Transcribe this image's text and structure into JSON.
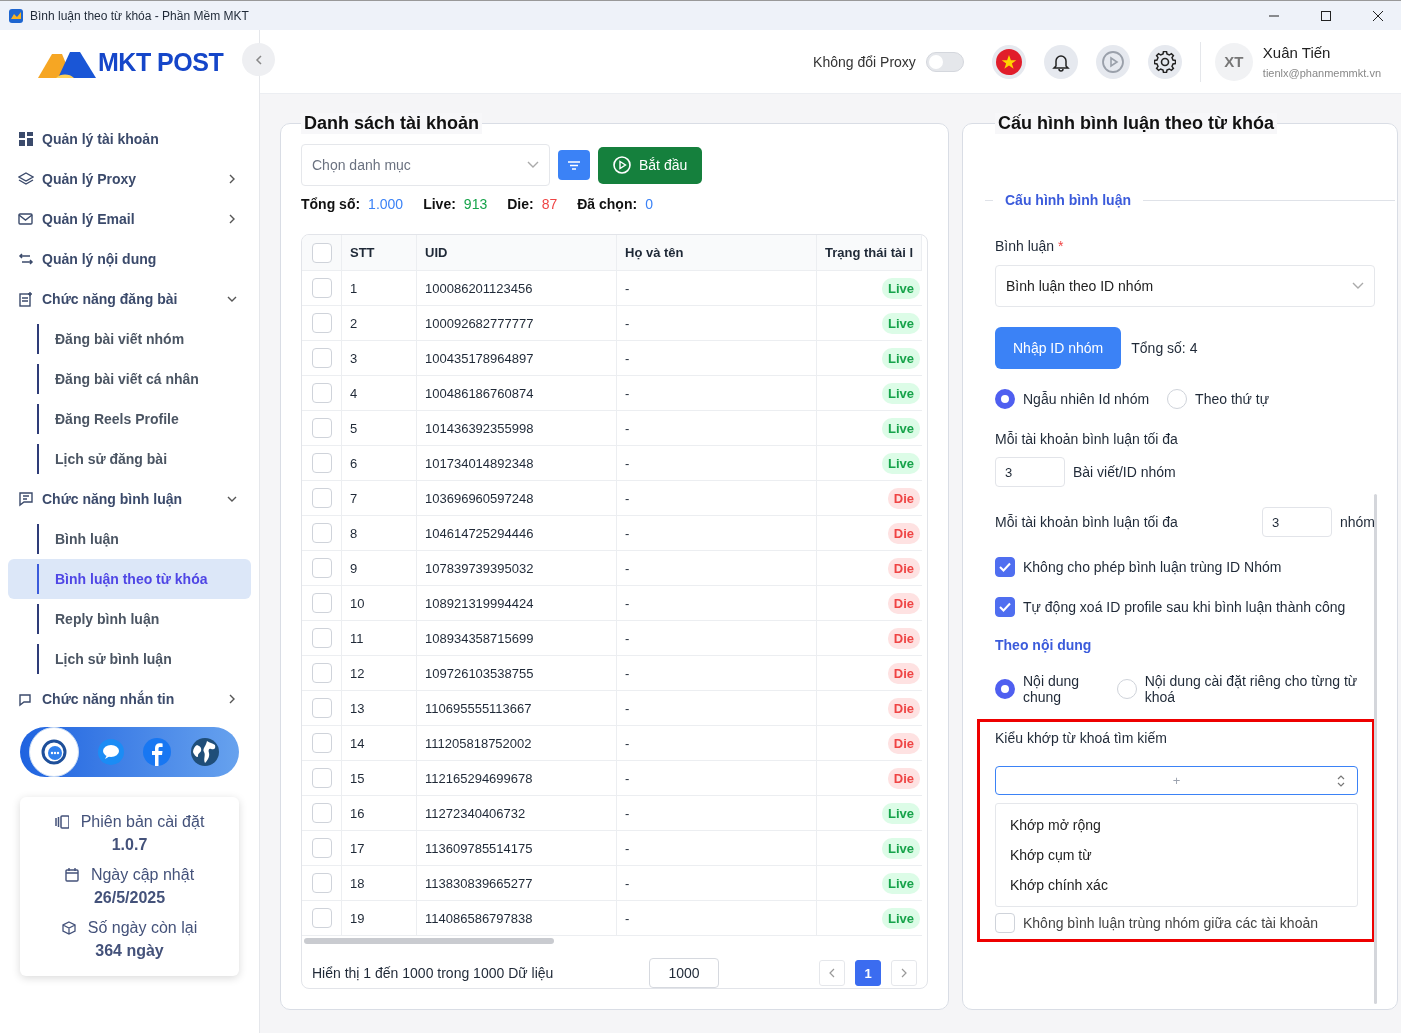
{
  "window": {
    "title": "Bình luận theo từ khóa - Phần Mềm MKT"
  },
  "logo": {
    "text": "MKT POST"
  },
  "sidebar": {
    "items": [
      {
        "label": "Quản lý tài khoản",
        "kind": "link"
      },
      {
        "label": "Quản lý Proxy",
        "kind": "group",
        "expanded": false
      },
      {
        "label": "Quản lý Email",
        "kind": "group",
        "expanded": false
      },
      {
        "label": "Quản lý nội dung",
        "kind": "link"
      },
      {
        "label": "Chức năng đăng bài",
        "kind": "group",
        "expanded": true,
        "children": [
          {
            "label": "Đăng bài viết nhóm",
            "selected": false
          },
          {
            "label": "Đăng bài viết cá nhân",
            "selected": false
          },
          {
            "label": "Đăng Reels Profile",
            "selected": false
          },
          {
            "label": "Lịch sử đăng bài",
            "selected": false
          }
        ]
      },
      {
        "label": "Chức năng bình luận",
        "kind": "group",
        "expanded": true,
        "children": [
          {
            "label": "Bình luận",
            "selected": false
          },
          {
            "label": "Bình luận theo từ khóa",
            "selected": true
          },
          {
            "label": "Reply bình luận",
            "selected": false
          },
          {
            "label": "Lịch sử bình luận",
            "selected": false
          }
        ]
      },
      {
        "label": "Chức năng nhắn tin",
        "kind": "group",
        "expanded": false
      }
    ]
  },
  "info": [
    {
      "label": "Phiên bản cài đặt",
      "value": "1.0.7"
    },
    {
      "label": "Ngày cập nhật",
      "value": "26/5/2025"
    },
    {
      "label": "Số ngày còn lại",
      "value": "364 ngày"
    }
  ],
  "header": {
    "proxy_label": "Không đổi Proxy",
    "proxy_on": false,
    "avatar": "XT",
    "user_name": "Xuân Tiến",
    "user_email": "tienlx@phanmemmkt.vn"
  },
  "accounts": {
    "title": "Danh sách tài khoản",
    "category_placeholder": "Chọn danh mục",
    "start_button": "Bắt đầu",
    "stats": [
      {
        "label": "Tổng số:",
        "value": "1.000",
        "kind": "total"
      },
      {
        "label": "Live:",
        "value": "913",
        "kind": "live"
      },
      {
        "label": "Die:",
        "value": "87",
        "kind": "die"
      },
      {
        "label": "Đã chọn:",
        "value": "0",
        "kind": "total"
      }
    ],
    "table": {
      "all_checked": false,
      "columns": [
        "STT",
        "UID",
        "Họ và tên",
        "Trạng thái tài l"
      ],
      "rows": [
        {
          "checked": false,
          "stt": "1",
          "uid": "100086201123456",
          "name": "-",
          "status": "Live",
          "kind": "live"
        },
        {
          "checked": false,
          "stt": "2",
          "uid": "100092682777777",
          "name": "-",
          "status": "Live",
          "kind": "live"
        },
        {
          "checked": false,
          "stt": "3",
          "uid": "100435178964897",
          "name": "-",
          "status": "Live",
          "kind": "live"
        },
        {
          "checked": false,
          "stt": "4",
          "uid": "100486186760874",
          "name": "-",
          "status": "Live",
          "kind": "live"
        },
        {
          "checked": false,
          "stt": "5",
          "uid": "101436392355998",
          "name": "-",
          "status": "Live",
          "kind": "live"
        },
        {
          "checked": false,
          "stt": "6",
          "uid": "101734014892348",
          "name": "-",
          "status": "Live",
          "kind": "live"
        },
        {
          "checked": false,
          "stt": "7",
          "uid": "103696960597248",
          "name": "-",
          "status": "Die",
          "kind": "die"
        },
        {
          "checked": false,
          "stt": "8",
          "uid": "104614725294446",
          "name": "-",
          "status": "Die",
          "kind": "die"
        },
        {
          "checked": false,
          "stt": "9",
          "uid": "107839739395032",
          "name": "-",
          "status": "Die",
          "kind": "die"
        },
        {
          "checked": false,
          "stt": "10",
          "uid": "108921319994424",
          "name": "-",
          "status": "Die",
          "kind": "die"
        },
        {
          "checked": false,
          "stt": "11",
          "uid": "108934358715699",
          "name": "-",
          "status": "Die",
          "kind": "die"
        },
        {
          "checked": false,
          "stt": "12",
          "uid": "109726103538755",
          "name": "-",
          "status": "Die",
          "kind": "die"
        },
        {
          "checked": false,
          "stt": "13",
          "uid": "110695555113667",
          "name": "-",
          "status": "Die",
          "kind": "die"
        },
        {
          "checked": false,
          "stt": "14",
          "uid": "111205818752002",
          "name": "-",
          "status": "Die",
          "kind": "die"
        },
        {
          "checked": false,
          "stt": "15",
          "uid": "112165294699678",
          "name": "-",
          "status": "Die",
          "kind": "die"
        },
        {
          "checked": false,
          "stt": "16",
          "uid": "11272340406732",
          "name": "-",
          "status": "Live",
          "kind": "live"
        },
        {
          "checked": false,
          "stt": "17",
          "uid": "113609785514175",
          "name": "-",
          "status": "Live",
          "kind": "live"
        },
        {
          "checked": false,
          "stt": "18",
          "uid": "113830839665277",
          "name": "-",
          "status": "Live",
          "kind": "live"
        },
        {
          "checked": false,
          "stt": "19",
          "uid": "114086586797838",
          "name": "-",
          "status": "Live",
          "kind": "live"
        }
      ]
    },
    "footer": {
      "summary": "Hiển thị 1 đến 1000 trong 1000 Dữ liệu",
      "page_size": "1000",
      "pages": [
        {
          "label": "1",
          "selected": true
        }
      ]
    }
  },
  "config": {
    "title": "Cấu hình bình luận theo từ khóa",
    "section": "Cấu hình bình luận",
    "comment_label": "Bình luận",
    "required_mark": "*",
    "comment_value": "Bình luận theo ID nhóm",
    "import_button": "Nhập ID nhóm",
    "import_total": "Tổng số: 4",
    "order_options": [
      {
        "label": "Ngẫu nhiên Id nhóm",
        "selected": true
      },
      {
        "label": "Theo thứ tự",
        "selected": false
      }
    ],
    "max_posts_label": "Mỗi tài khoản bình luận tối đa",
    "max_posts_value": "3",
    "max_posts_unit": "Bài viết/ID nhóm",
    "max_groups_label": "Mỗi tài khoản bình luận tối đa",
    "max_groups_value": "3",
    "max_groups_unit": "nhóm",
    "checks": [
      {
        "label": "Không cho phép bình luận trùng ID Nhóm",
        "checked": true
      },
      {
        "label": "Tự động xoá ID profile sau khi bình luận thành công",
        "checked": true
      }
    ],
    "content_heading": "Theo nội dung",
    "content_options": [
      {
        "label": "Nội dung chung",
        "selected": true
      },
      {
        "label": "Nội dung cài đặt riêng cho từng từ khoá",
        "selected": false
      }
    ],
    "match_label": "Kiểu khớp từ khoá tìm kiếm",
    "match_placeholder": "+",
    "match_options": [
      "Khớp mở rộng",
      "Khớp cụm từ",
      "Khớp chính xác"
    ],
    "no_dup": {
      "label": "Không bình luận trùng nhóm giữa các tài khoản",
      "checked": false
    }
  }
}
